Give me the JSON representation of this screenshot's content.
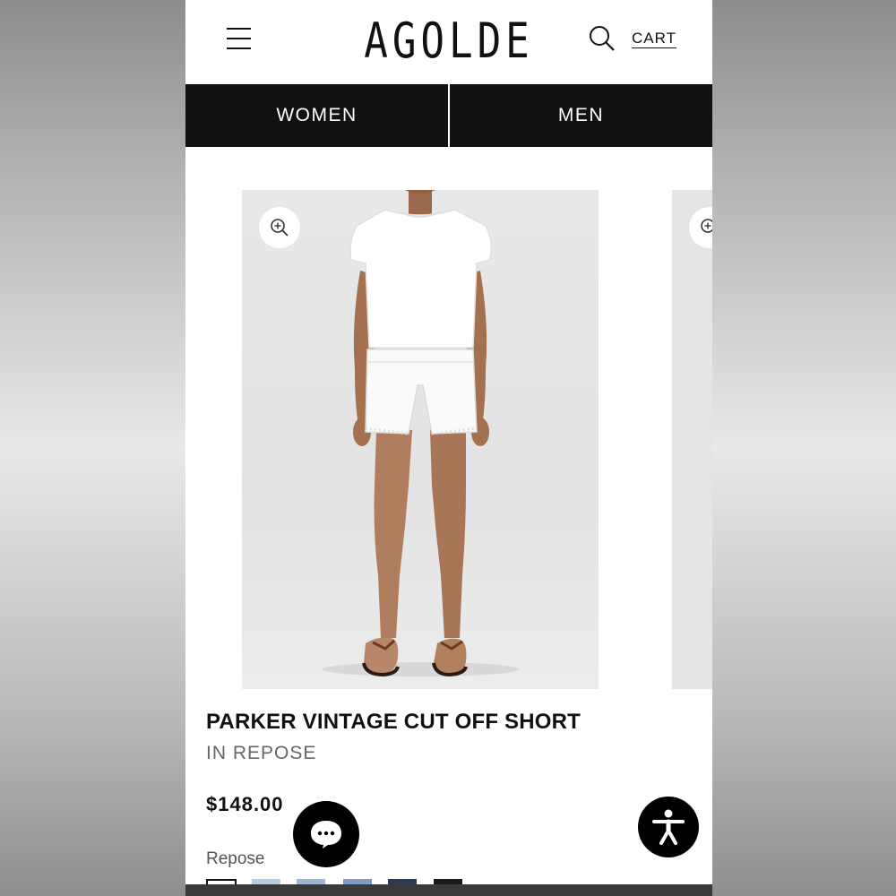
{
  "header": {
    "logo": "AGOLDE",
    "cart_label": "CART",
    "menu_icon": "hamburger-menu-icon",
    "search_icon": "search-icon"
  },
  "nav": {
    "tabs": [
      {
        "label": "WOMEN"
      },
      {
        "label": "MEN"
      }
    ]
  },
  "product": {
    "title": "PARKER VINTAGE CUT OFF SHORT",
    "color_name": "IN REPOSE",
    "price": "$148.00",
    "swatch_label": "Repose",
    "zoom_icon": "zoom-in-icon",
    "image_subject": "Model wearing white t-shirt and white cut off shorts",
    "swatches": [
      {
        "color": "#ffffff",
        "selected": true
      },
      {
        "color": "#b8cbe0"
      },
      {
        "color": "#9fb6d2"
      },
      {
        "color": "#7f9cc2"
      },
      {
        "color": "#2c3c57"
      },
      {
        "color": "#1a1a1a"
      }
    ]
  },
  "widgets": {
    "chat_icon": "chat-bubble-icon",
    "accessibility_icon": "accessibility-icon"
  },
  "colors": {
    "nav_bg": "#111111",
    "accent": "#000000"
  }
}
